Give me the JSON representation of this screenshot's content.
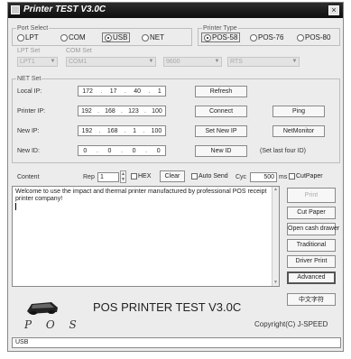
{
  "window": {
    "title": "Printer TEST V3.0C",
    "close_glyph": "×"
  },
  "port_select": {
    "label": "Port Select",
    "options": [
      "LPT",
      "COM",
      "USB",
      "NET"
    ],
    "selected": "USB"
  },
  "printer_type": {
    "label": "Printer Type",
    "options": [
      "POS-58",
      "POS-76",
      "POS-80"
    ],
    "selected": "POS-58"
  },
  "lpt_set": {
    "label": "LPT Set",
    "value": "LPT1"
  },
  "com_set": {
    "label": "COM Set",
    "port": "COM1",
    "baud": "9600",
    "flow": "RTS"
  },
  "net_set": {
    "label": "NET Set",
    "rows": [
      {
        "label": "Local IP:",
        "ip": [
          "172",
          "17",
          "40",
          "1"
        ],
        "button": "Refresh"
      },
      {
        "label": "Printer IP:",
        "ip": [
          "192",
          "168",
          "123",
          "100"
        ],
        "button": "Connect",
        "extra_button": "Ping"
      },
      {
        "label": "New IP:",
        "ip": [
          "192",
          "168",
          "1",
          "100"
        ],
        "button": "Set New IP",
        "extra_button": "NetMonitor"
      },
      {
        "label": "New ID:",
        "ip": [
          "0",
          "0",
          "0",
          "0"
        ],
        "button": "New ID",
        "note": "(Set last four ID)"
      }
    ]
  },
  "content_bar": {
    "content_label": "Content",
    "rep_label": "Rep",
    "rep_value": "1",
    "hex_label": "HEX",
    "clear_label": "Clear",
    "auto_send_label": "Auto Send",
    "cyc_label": "Cyc",
    "cyc_value": "500",
    "ms_label": "ms",
    "cut_paper_label": "CutPaper"
  },
  "content_text": "Welcome to use the impact and thermal printer manufactured by professional POS receipt printer company!",
  "side_buttons": [
    "Print",
    "Cut Paper",
    "Open cash drawer",
    "Traditional",
    "Driver Print",
    "Advanced",
    "中文字符"
  ],
  "footer": {
    "app_title": "POS PRINTER TEST V3.0C",
    "copyright": "Copyright(C) J-SPEED",
    "logo_text": "P O S",
    "status": "USB"
  },
  "colors": {
    "titlebar": "#111111",
    "window_bg": "#ececec",
    "border": "#888888"
  }
}
